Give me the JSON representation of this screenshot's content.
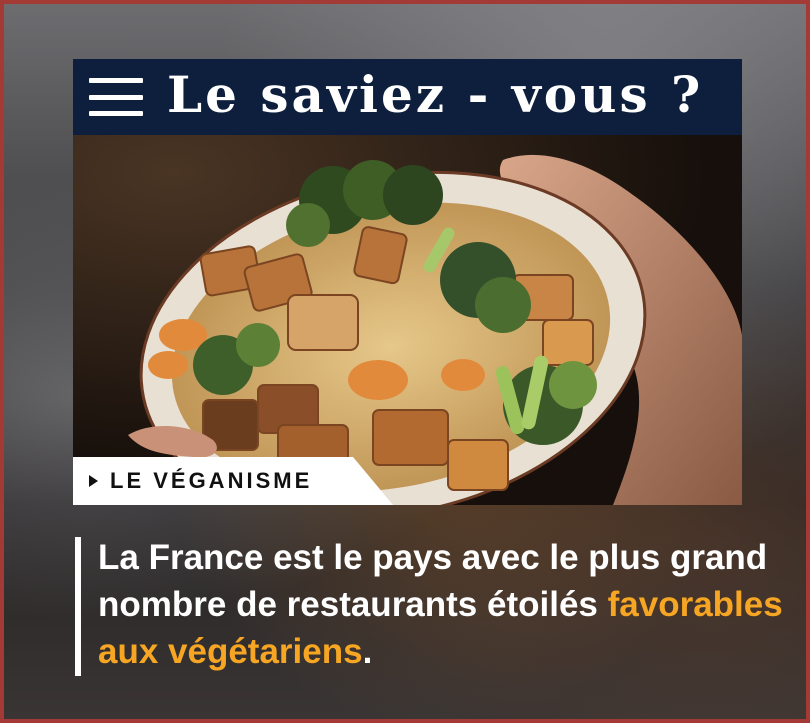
{
  "header": {
    "title": "Le saviez - vous ?",
    "menu_icon": "hamburger-menu-icon",
    "background_color": "#0e1f3d"
  },
  "photo": {
    "subject": "vegan bowl with tofu, broccoli and sweet potato in creamy sauce, held in hands"
  },
  "tag": {
    "label": "LE VÉGANISME",
    "icon": "play-triangle-icon"
  },
  "fact": {
    "text_before": "La France est le pays avec le plus grand nombre de restaurants étoilés ",
    "highlight": "favorables aux végétariens",
    "text_after": ".",
    "highlight_color": "#f6a623"
  },
  "colors": {
    "frame_border": "#a43a35",
    "text": "#ffffff"
  }
}
